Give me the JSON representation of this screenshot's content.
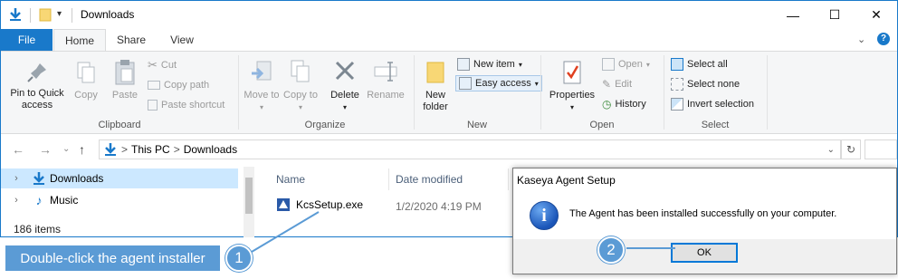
{
  "window": {
    "title": "Downloads",
    "controls": {
      "minimize": "—",
      "maximize": "☐",
      "close": "✕"
    }
  },
  "ribbon": {
    "tabs": [
      {
        "label": "File"
      },
      {
        "label": "Home"
      },
      {
        "label": "Share"
      },
      {
        "label": "View"
      }
    ],
    "clipboard": {
      "label": "Clipboard",
      "pin": "Pin to Quick access",
      "copy": "Copy",
      "paste": "Paste",
      "cut": "Cut",
      "copy_path": "Copy path",
      "paste_shortcut": "Paste shortcut"
    },
    "organize": {
      "label": "Organize",
      "move_to": "Move to",
      "copy_to": "Copy to",
      "delete": "Delete",
      "rename": "Rename"
    },
    "new": {
      "label": "New",
      "new_folder": "New folder",
      "new_item": "New item",
      "easy_access": "Easy access"
    },
    "open": {
      "label": "Open",
      "properties": "Properties",
      "open": "Open",
      "edit": "Edit",
      "history": "History"
    },
    "select": {
      "label": "Select",
      "select_all": "Select all",
      "select_none": "Select none",
      "invert": "Invert selection"
    }
  },
  "address": {
    "path": [
      "This PC",
      "Downloads"
    ],
    "separator": ">"
  },
  "navpane": {
    "items": [
      {
        "label": "Downloads",
        "selected": true
      },
      {
        "label": "Music",
        "selected": false
      }
    ],
    "status": "186 items"
  },
  "filelist": {
    "columns": [
      "Name",
      "Date modified"
    ],
    "rows": [
      {
        "name": "KcsSetup.exe",
        "date": "1/2/2020 4:19 PM"
      }
    ]
  },
  "dialog": {
    "title": "Kaseya Agent Setup",
    "message": "The Agent has been installed successfully on your computer.",
    "ok": "OK"
  },
  "callouts": {
    "step1_label": "Double-click the agent installer",
    "step1_number": "1",
    "step2_number": "2"
  },
  "colors": {
    "accent": "#1979ca",
    "callout": "#5b9bd5",
    "selection": "#cce8ff"
  }
}
